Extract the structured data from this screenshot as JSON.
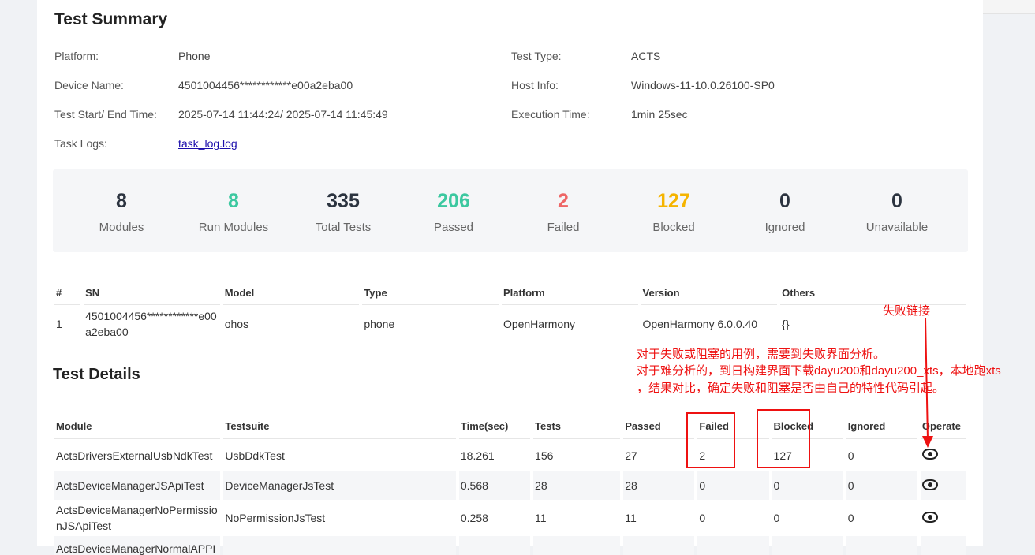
{
  "summary": {
    "title": "Test Summary",
    "platform_label": "Platform:",
    "platform": "Phone",
    "test_type_label": "Test Type:",
    "test_type": "ACTS",
    "device_name_label": "Device Name:",
    "device_name": "4501004456************e00a2eba00",
    "host_info_label": "Host Info:",
    "host_info": "Windows-11-10.0.26100-SP0",
    "time_label": "Test Start/ End Time:",
    "time": "2025-07-14 11:44:24/ 2025-07-14 11:45:49",
    "exec_label": "Execution Time:",
    "exec": "1min 25sec",
    "logs_label": "Task Logs:",
    "logs": "task_log.log"
  },
  "stats": [
    {
      "value": "8",
      "label": "Modules",
      "color": "#2c3440"
    },
    {
      "value": "8",
      "label": "Run Modules",
      "color": "#3cc8a0"
    },
    {
      "value": "335",
      "label": "Total Tests",
      "color": "#2c3440"
    },
    {
      "value": "206",
      "label": "Passed",
      "color": "#3cc8a0"
    },
    {
      "value": "2",
      "label": "Failed",
      "color": "#ee6666"
    },
    {
      "value": "127",
      "label": "Blocked",
      "color": "#f5b400"
    },
    {
      "value": "0",
      "label": "Ignored",
      "color": "#2c3440"
    },
    {
      "value": "0",
      "label": "Unavailable",
      "color": "#2c3440"
    }
  ],
  "device_table": {
    "headers": [
      "#",
      "SN",
      "Model",
      "Type",
      "Platform",
      "Version",
      "Others"
    ],
    "rows": [
      {
        "idx": "1",
        "sn": "4501004456************e00a2eba00",
        "model": "ohos",
        "type": "phone",
        "platform": "OpenHarmony",
        "version": "OpenHarmony 6.0.0.40",
        "others": "{}"
      }
    ]
  },
  "details": {
    "title": "Test Details",
    "headers": [
      "Module",
      "Testsuite",
      "Time(sec)",
      "Tests",
      "Passed",
      "Failed",
      "Blocked",
      "Ignored",
      "Operate"
    ],
    "rows": [
      {
        "module": "ActsDriversExternalUsbNdkTest",
        "suite": "UsbDdkTest",
        "time": "18.261",
        "tests": "156",
        "passed": "27",
        "failed": "2",
        "blocked": "127",
        "ignored": "0"
      },
      {
        "module": "ActsDeviceManagerJSApiTest",
        "suite": "DeviceManagerJsTest",
        "time": "0.568",
        "tests": "28",
        "passed": "28",
        "failed": "0",
        "blocked": "0",
        "ignored": "0"
      },
      {
        "module": "ActsDeviceManagerNoPermissionJSApiTest",
        "suite": "NoPermissionJsTest",
        "time": "0.258",
        "tests": "11",
        "passed": "11",
        "failed": "0",
        "blocked": "0",
        "ignored": "0"
      },
      {
        "module": "ActsDeviceManagerNormalAPPI",
        "suite": "",
        "time": "",
        "tests": "",
        "passed": "",
        "failed": "",
        "blocked": "",
        "ignored": ""
      }
    ]
  },
  "annotation": {
    "link_label": "失败链接",
    "line1": "对于失败或阻塞的用例，需要到失败界面分析。",
    "line2": "对于难分析的，到日构建界面下载dayu200和dayu200_xts，本地跑xts",
    "line3": "，结果对比，确定失败和阻塞是否由自己的特性代码引起。",
    "color": "#ee1111"
  }
}
